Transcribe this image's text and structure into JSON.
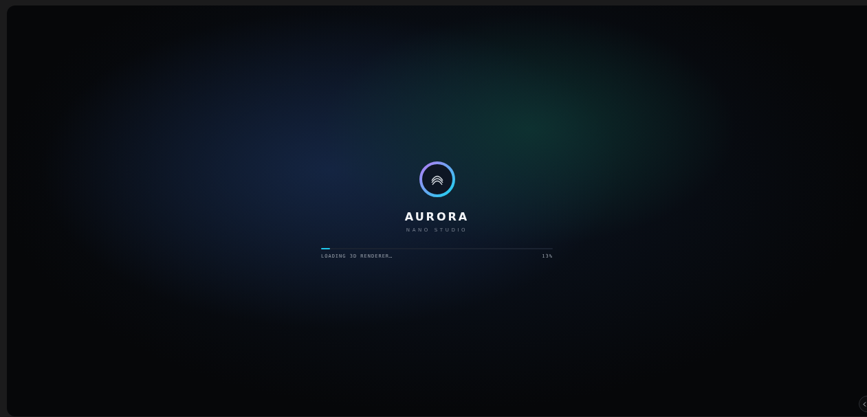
{
  "brand": {
    "title": "AURORA",
    "subtitle": "NANO STUDIO"
  },
  "loader": {
    "status": "LOADING 3D RENDERER…",
    "percent": "13%",
    "level": 0.04
  }
}
